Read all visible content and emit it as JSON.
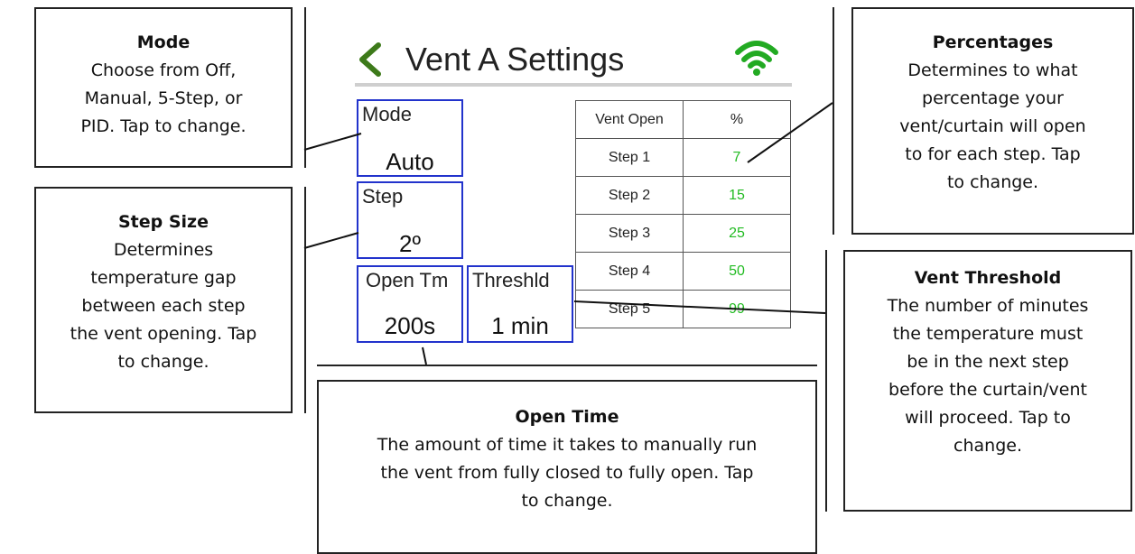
{
  "callouts": {
    "mode": {
      "title": "Mode",
      "lines": [
        "Choose from Off,",
        "Manual, 5-Step, or",
        "PID. Tap to change."
      ]
    },
    "step_size": {
      "title": "Step Size",
      "lines": [
        "Determines",
        "temperature gap",
        "between each step",
        "the vent opening. Tap",
        "to change."
      ]
    },
    "percentages": {
      "title": "Percentages",
      "lines": [
        "Determines to what",
        "percentage your",
        "vent/curtain will open",
        "to for each step. Tap",
        "to change."
      ]
    },
    "vent_threshold": {
      "title": "Vent Threshold",
      "lines": [
        "The number of minutes",
        "the temperature must",
        "be in the next step",
        "before the curtain/vent",
        "will proceed. Tap to",
        "change."
      ]
    },
    "open_time": {
      "title": "Open Time",
      "lines": [
        "The amount of time it takes to manually run",
        "the vent from fully closed to fully open. Tap",
        "to change."
      ]
    }
  },
  "screen": {
    "title": "Vent A Settings",
    "back_icon": "chevron-left-icon",
    "status_icon": "wifi-icon",
    "accent_color": "#3d7a1a",
    "wifi_color": "#22aa22",
    "tile_border_color": "#2233cc",
    "mode": {
      "label": "Mode",
      "value": "Auto"
    },
    "step": {
      "label": "Step",
      "value": "2º"
    },
    "open_tm": {
      "label": "Open Tm",
      "value": "200s"
    },
    "threshld": {
      "label": "Threshld",
      "value": "1 min"
    },
    "table": {
      "headers": [
        "Vent Open",
        "%"
      ],
      "rows": [
        {
          "step": "Step 1",
          "pct": "7"
        },
        {
          "step": "Step 2",
          "pct": "15"
        },
        {
          "step": "Step 3",
          "pct": "25"
        },
        {
          "step": "Step 4",
          "pct": "50"
        },
        {
          "step": "Step 5",
          "pct": "99"
        }
      ],
      "pct_color": "#22bb22"
    }
  }
}
